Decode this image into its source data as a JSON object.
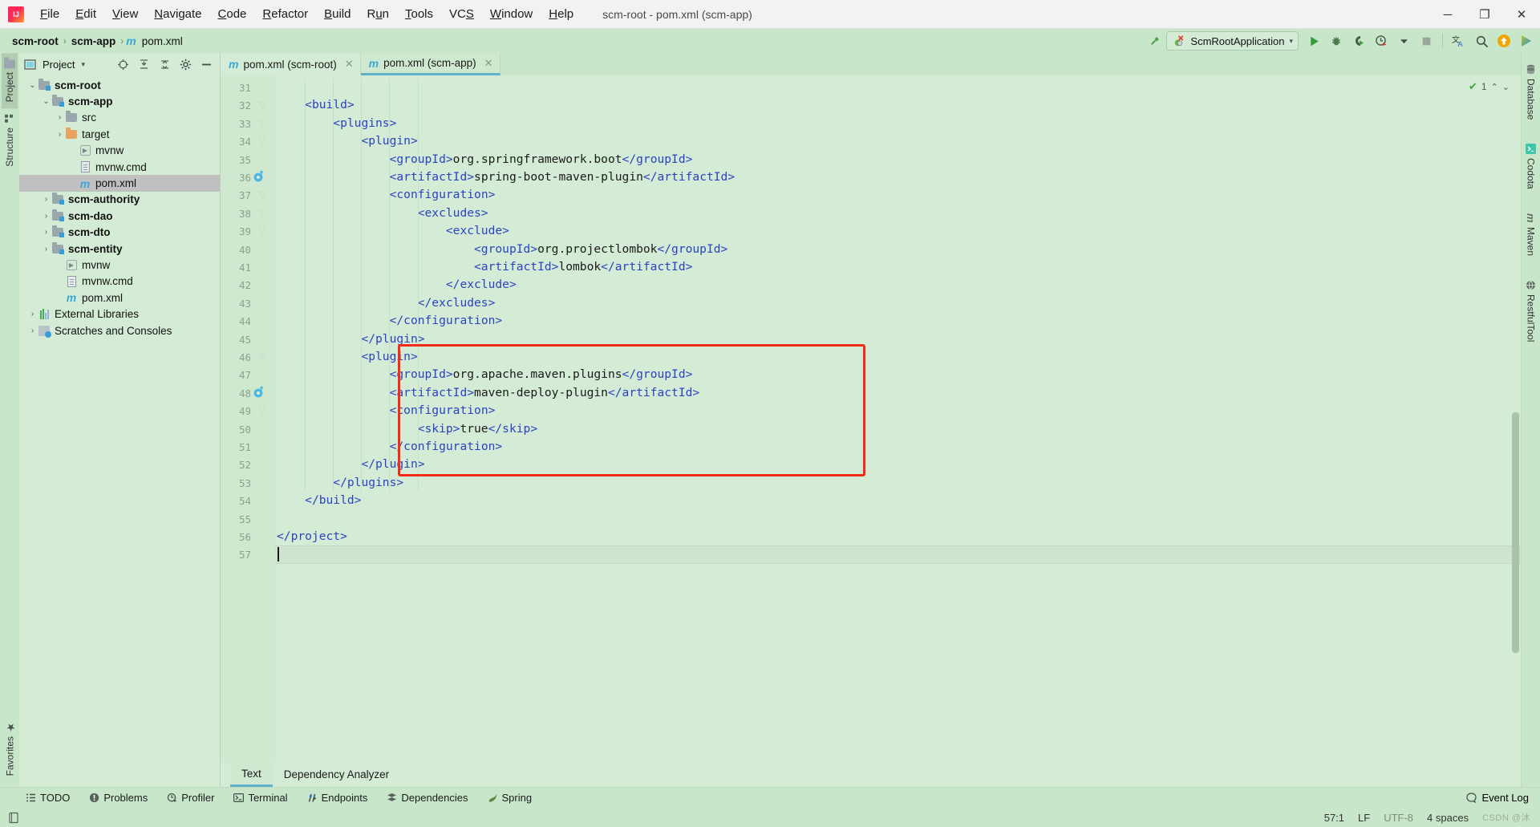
{
  "window": {
    "title": "scm-root - pom.xml (scm-app)",
    "minimize": "─",
    "maximize": "❐",
    "close": "✕"
  },
  "menu": {
    "items": [
      {
        "label": "File",
        "mnemonic": "F"
      },
      {
        "label": "Edit",
        "mnemonic": "E"
      },
      {
        "label": "View",
        "mnemonic": "V"
      },
      {
        "label": "Navigate",
        "mnemonic": "N"
      },
      {
        "label": "Code",
        "mnemonic": "C"
      },
      {
        "label": "Refactor",
        "mnemonic": "R"
      },
      {
        "label": "Build",
        "mnemonic": "B"
      },
      {
        "label": "Run",
        "mnemonic": "u"
      },
      {
        "label": "Tools",
        "mnemonic": "T"
      },
      {
        "label": "VCS",
        "mnemonic": "S"
      },
      {
        "label": "Window",
        "mnemonic": "W"
      },
      {
        "label": "Help",
        "mnemonic": "H"
      }
    ]
  },
  "breadcrumb": {
    "items": [
      "scm-root",
      "scm-app",
      "pom.xml"
    ],
    "separator": "›",
    "file_icon": "m"
  },
  "toolbar": {
    "build_label": "build-hammer-icon",
    "run_config": "ScmRootApplication",
    "run_config_dropdown": "▾",
    "buttons": [
      {
        "name": "run-button",
        "glyph": "▶"
      },
      {
        "name": "debug-button",
        "glyph": "bug"
      },
      {
        "name": "run-with-coverage-button",
        "glyph": "coverage"
      },
      {
        "name": "profiler-button",
        "glyph": "profiler"
      },
      {
        "name": "stop-button",
        "glyph": "■"
      },
      {
        "name": "translate-button",
        "glyph": "translate"
      },
      {
        "name": "search-everywhere-button",
        "glyph": "⚲"
      },
      {
        "name": "update-button",
        "glyph": "↑"
      },
      {
        "name": "ide-eye-button",
        "glyph": "eye"
      }
    ]
  },
  "left_strip": {
    "tabs": [
      {
        "label": "Project",
        "active": true
      },
      {
        "label": "Structure",
        "active": false
      }
    ],
    "bottom_tab": {
      "label": "Favorites"
    }
  },
  "right_strip": {
    "tabs": [
      {
        "label": "Database"
      },
      {
        "label": "Codota"
      },
      {
        "label": "Maven"
      },
      {
        "label": "RestfulTool"
      }
    ]
  },
  "project_panel": {
    "title": "Project",
    "title_dropdown": "▾",
    "actions": [
      "locate-icon",
      "expand-all-icon",
      "collapse-all-icon",
      "settings-gear-icon",
      "hide-icon"
    ],
    "tree": [
      {
        "label": "scm-root",
        "depth": 0,
        "arrow": "⌄",
        "icon": "module-folder",
        "bold": true,
        "selected": false
      },
      {
        "label": "scm-app",
        "depth": 1,
        "arrow": "⌄",
        "icon": "module-folder",
        "bold": true,
        "selected": false
      },
      {
        "label": "src",
        "depth": 2,
        "arrow": "›",
        "icon": "folder",
        "bold": false,
        "selected": false
      },
      {
        "label": "target",
        "depth": 2,
        "arrow": "›",
        "icon": "folder-orange",
        "bold": false,
        "selected": false
      },
      {
        "label": "mvnw",
        "depth": 3,
        "arrow": "",
        "icon": "script",
        "bold": false,
        "selected": false
      },
      {
        "label": "mvnw.cmd",
        "depth": 3,
        "arrow": "",
        "icon": "document",
        "bold": false,
        "selected": false
      },
      {
        "label": "pom.xml",
        "depth": 3,
        "arrow": "",
        "icon": "maven",
        "bold": false,
        "selected": true
      },
      {
        "label": "scm-authority",
        "depth": 1,
        "arrow": "›",
        "icon": "module-folder",
        "bold": true,
        "selected": false
      },
      {
        "label": "scm-dao",
        "depth": 1,
        "arrow": "›",
        "icon": "module-folder",
        "bold": true,
        "selected": false
      },
      {
        "label": "scm-dto",
        "depth": 1,
        "arrow": "›",
        "icon": "module-folder",
        "bold": true,
        "selected": false
      },
      {
        "label": "scm-entity",
        "depth": 1,
        "arrow": "›",
        "icon": "module-folder",
        "bold": true,
        "selected": false
      },
      {
        "label": "mvnw",
        "depth": 2,
        "arrow": "",
        "icon": "script",
        "bold": false,
        "selected": false
      },
      {
        "label": "mvnw.cmd",
        "depth": 2,
        "arrow": "",
        "icon": "document",
        "bold": false,
        "selected": false
      },
      {
        "label": "pom.xml",
        "depth": 2,
        "arrow": "",
        "icon": "maven",
        "bold": false,
        "selected": false
      },
      {
        "label": "External Libraries",
        "depth": 0,
        "arrow": "›",
        "icon": "libraries",
        "bold": false,
        "selected": false
      },
      {
        "label": "Scratches and Consoles",
        "depth": 0,
        "arrow": "›",
        "icon": "scratches",
        "bold": false,
        "selected": false
      }
    ]
  },
  "editor": {
    "tabs": [
      {
        "label": "pom.xml (scm-root)",
        "icon": "m",
        "active": false,
        "close": "✕"
      },
      {
        "label": "pom.xml (scm-app)",
        "icon": "m",
        "active": true,
        "close": "✕"
      }
    ],
    "inspection": {
      "check": "✔",
      "count": "1",
      "up": "⌃",
      "down": "⌄"
    },
    "first_line_number": 31,
    "lines": [
      {
        "n": 31,
        "text": "",
        "fold": false,
        "bean": false
      },
      {
        "n": 32,
        "text": "    <build>",
        "fold": true,
        "bean": false
      },
      {
        "n": 33,
        "text": "        <plugins>",
        "fold": true,
        "bean": false
      },
      {
        "n": 34,
        "text": "            <plugin>",
        "fold": true,
        "bean": false
      },
      {
        "n": 35,
        "text": "                <groupId>org.springframework.boot</groupId>",
        "fold": false,
        "bean": false
      },
      {
        "n": 36,
        "text": "                <artifactId>spring-boot-maven-plugin</artifactId>",
        "fold": false,
        "bean": true
      },
      {
        "n": 37,
        "text": "                <configuration>",
        "fold": true,
        "bean": false
      },
      {
        "n": 38,
        "text": "                    <excludes>",
        "fold": true,
        "bean": false
      },
      {
        "n": 39,
        "text": "                        <exclude>",
        "fold": true,
        "bean": false
      },
      {
        "n": 40,
        "text": "                            <groupId>org.projectlombok</groupId>",
        "fold": false,
        "bean": false
      },
      {
        "n": 41,
        "text": "                            <artifactId>lombok</artifactId>",
        "fold": false,
        "bean": false
      },
      {
        "n": 42,
        "text": "                        </exclude>",
        "fold": false,
        "bean": false
      },
      {
        "n": 43,
        "text": "                    </excludes>",
        "fold": false,
        "bean": false
      },
      {
        "n": 44,
        "text": "                </configuration>",
        "fold": false,
        "bean": false
      },
      {
        "n": 45,
        "text": "            </plugin>",
        "fold": false,
        "bean": false
      },
      {
        "n": 46,
        "text": "            <plugin>",
        "fold": true,
        "bean": false
      },
      {
        "n": 47,
        "text": "                <groupId>org.apache.maven.plugins</groupId>",
        "fold": false,
        "bean": false
      },
      {
        "n": 48,
        "text": "                <artifactId>maven-deploy-plugin</artifactId>",
        "fold": false,
        "bean": true
      },
      {
        "n": 49,
        "text": "                <configuration>",
        "fold": true,
        "bean": false
      },
      {
        "n": 50,
        "text": "                    <skip>true</skip>",
        "fold": false,
        "bean": false
      },
      {
        "n": 51,
        "text": "                </configuration>",
        "fold": false,
        "bean": false
      },
      {
        "n": 52,
        "text": "            </plugin>",
        "fold": false,
        "bean": false
      },
      {
        "n": 53,
        "text": "        </plugins>",
        "fold": false,
        "bean": false
      },
      {
        "n": 54,
        "text": "    </build>",
        "fold": false,
        "bean": false
      },
      {
        "n": 55,
        "text": "",
        "fold": false,
        "bean": false
      },
      {
        "n": 56,
        "text": "</project>",
        "fold": false,
        "bean": false
      },
      {
        "n": 57,
        "text": "",
        "fold": false,
        "bean": false
      }
    ],
    "highlight_box": {
      "from_line": 46,
      "to_line": 52,
      "color": "#f52b15"
    },
    "caret_line": 57,
    "sub_tabs": [
      {
        "label": "Text",
        "active": true
      },
      {
        "label": "Dependency Analyzer",
        "active": false
      }
    ]
  },
  "bottom_strip": {
    "tools": [
      {
        "label": "TODO",
        "icon": "todo-icon"
      },
      {
        "label": "Problems",
        "icon": "problems-icon"
      },
      {
        "label": "Profiler",
        "icon": "profiler-icon"
      },
      {
        "label": "Terminal",
        "icon": "terminal-icon"
      },
      {
        "label": "Endpoints",
        "icon": "endpoints-icon"
      },
      {
        "label": "Dependencies",
        "icon": "dependencies-icon"
      },
      {
        "label": "Spring",
        "icon": "spring-icon"
      }
    ],
    "event_log": "Event Log"
  },
  "status_bar": {
    "caret_position": "57:1",
    "line_separator": "LF",
    "encoding": "UTF-8",
    "indent": "4 spaces",
    "watermark": "CSDN @沐"
  }
}
